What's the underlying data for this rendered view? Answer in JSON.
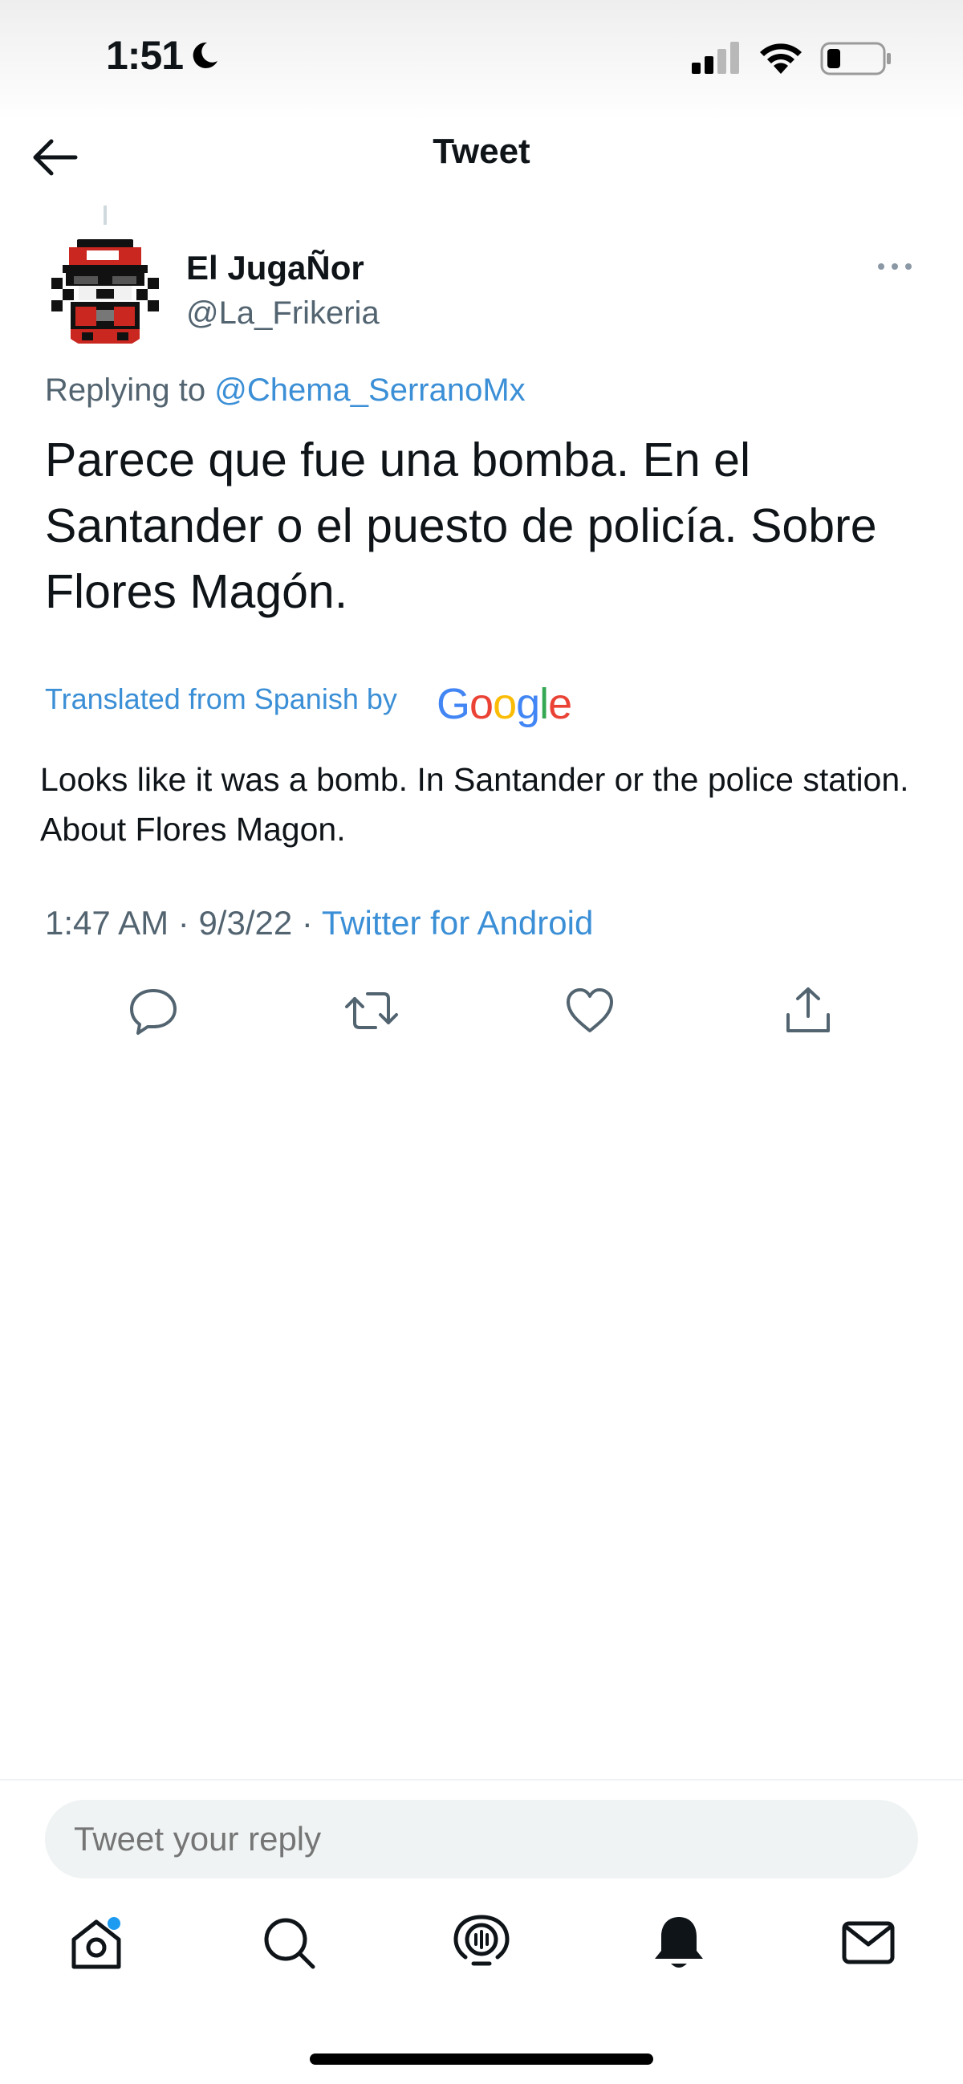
{
  "status_bar": {
    "time": "1:51",
    "icons": [
      "moon-icon",
      "signal-icon",
      "wifi-icon",
      "battery-icon"
    ]
  },
  "header": {
    "title": "Tweet",
    "back_icon": "arrow-left-icon"
  },
  "tweet": {
    "author_name": "El JugaÑor",
    "author_handle": "@La_Frikeria",
    "replying_prefix": "Replying to",
    "replying_mention": "@Chema_SerranoMx",
    "text": "Parece que fue una bomba. En el Santander o el puesto de policía. Sobre Flores Magón.",
    "translated_label": "Translated from Spanish by",
    "translated_brand": "Google",
    "translation": "Looks like it was a bomb. In Santander or the police station. About Flores Magon.",
    "time": "1:47 AM",
    "separator": "·",
    "date": "9/3/22",
    "source": "Twitter for Android"
  },
  "actions": [
    "reply-icon",
    "retweet-icon",
    "like-icon",
    "share-icon"
  ],
  "composer": {
    "placeholder": "Tweet your reply"
  },
  "tabbar": [
    "home-icon",
    "search-icon",
    "spaces-icon",
    "notifications-icon",
    "messages-icon"
  ],
  "colors": {
    "link": "#3b8fd6",
    "secondary_text": "#536471",
    "notification_dot": "#1d9bf0"
  }
}
